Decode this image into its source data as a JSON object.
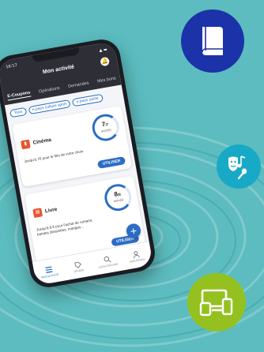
{
  "app": {
    "status_time": "16:17",
    "status_icons": "▲ ▬",
    "title": "Mon activité",
    "tabs": [
      "E-Coupons",
      "Opérations",
      "Demandes",
      "Mes bons"
    ],
    "active_tab": "E-Coupons"
  },
  "filters": [
    "Tous",
    "e.pass culture sport",
    "e.pass santé"
  ],
  "coupons": [
    {
      "name": "Cinéma",
      "amount": "7",
      "amount_suffix": "/7",
      "unit": "euro(s)",
      "description": "Jusqu'à 7€ pour le film de votre choix",
      "action": "UTILISER",
      "icon": "cinema-ticket-icon",
      "fill": 0.85
    },
    {
      "name": "Livre",
      "amount": "8",
      "amount_suffix": "/8",
      "unit": "euro(s)",
      "description": "Jusqu'à 8 € pour l'achat de romans, bandes dessinées, mangas...",
      "action": "UTILISER",
      "icon": "book-icon",
      "fill": 0.85
    }
  ],
  "fab": "+",
  "bottom_nav": [
    "MON ACTIVITÉ",
    "OFFRES",
    "LOCALISATIONS",
    "MON PROFIL"
  ],
  "badges": [
    "book-icon",
    "theater-music-icon",
    "devices-icon"
  ],
  "colors": {
    "background": "#5cbcbf",
    "header": "#2e2f36",
    "accent": "#2b6cc4",
    "coupon_icon": "#e8552f",
    "badge_book": "#1c32a8",
    "badge_music": "#18a9c6",
    "badge_devices": "#94c11f"
  }
}
